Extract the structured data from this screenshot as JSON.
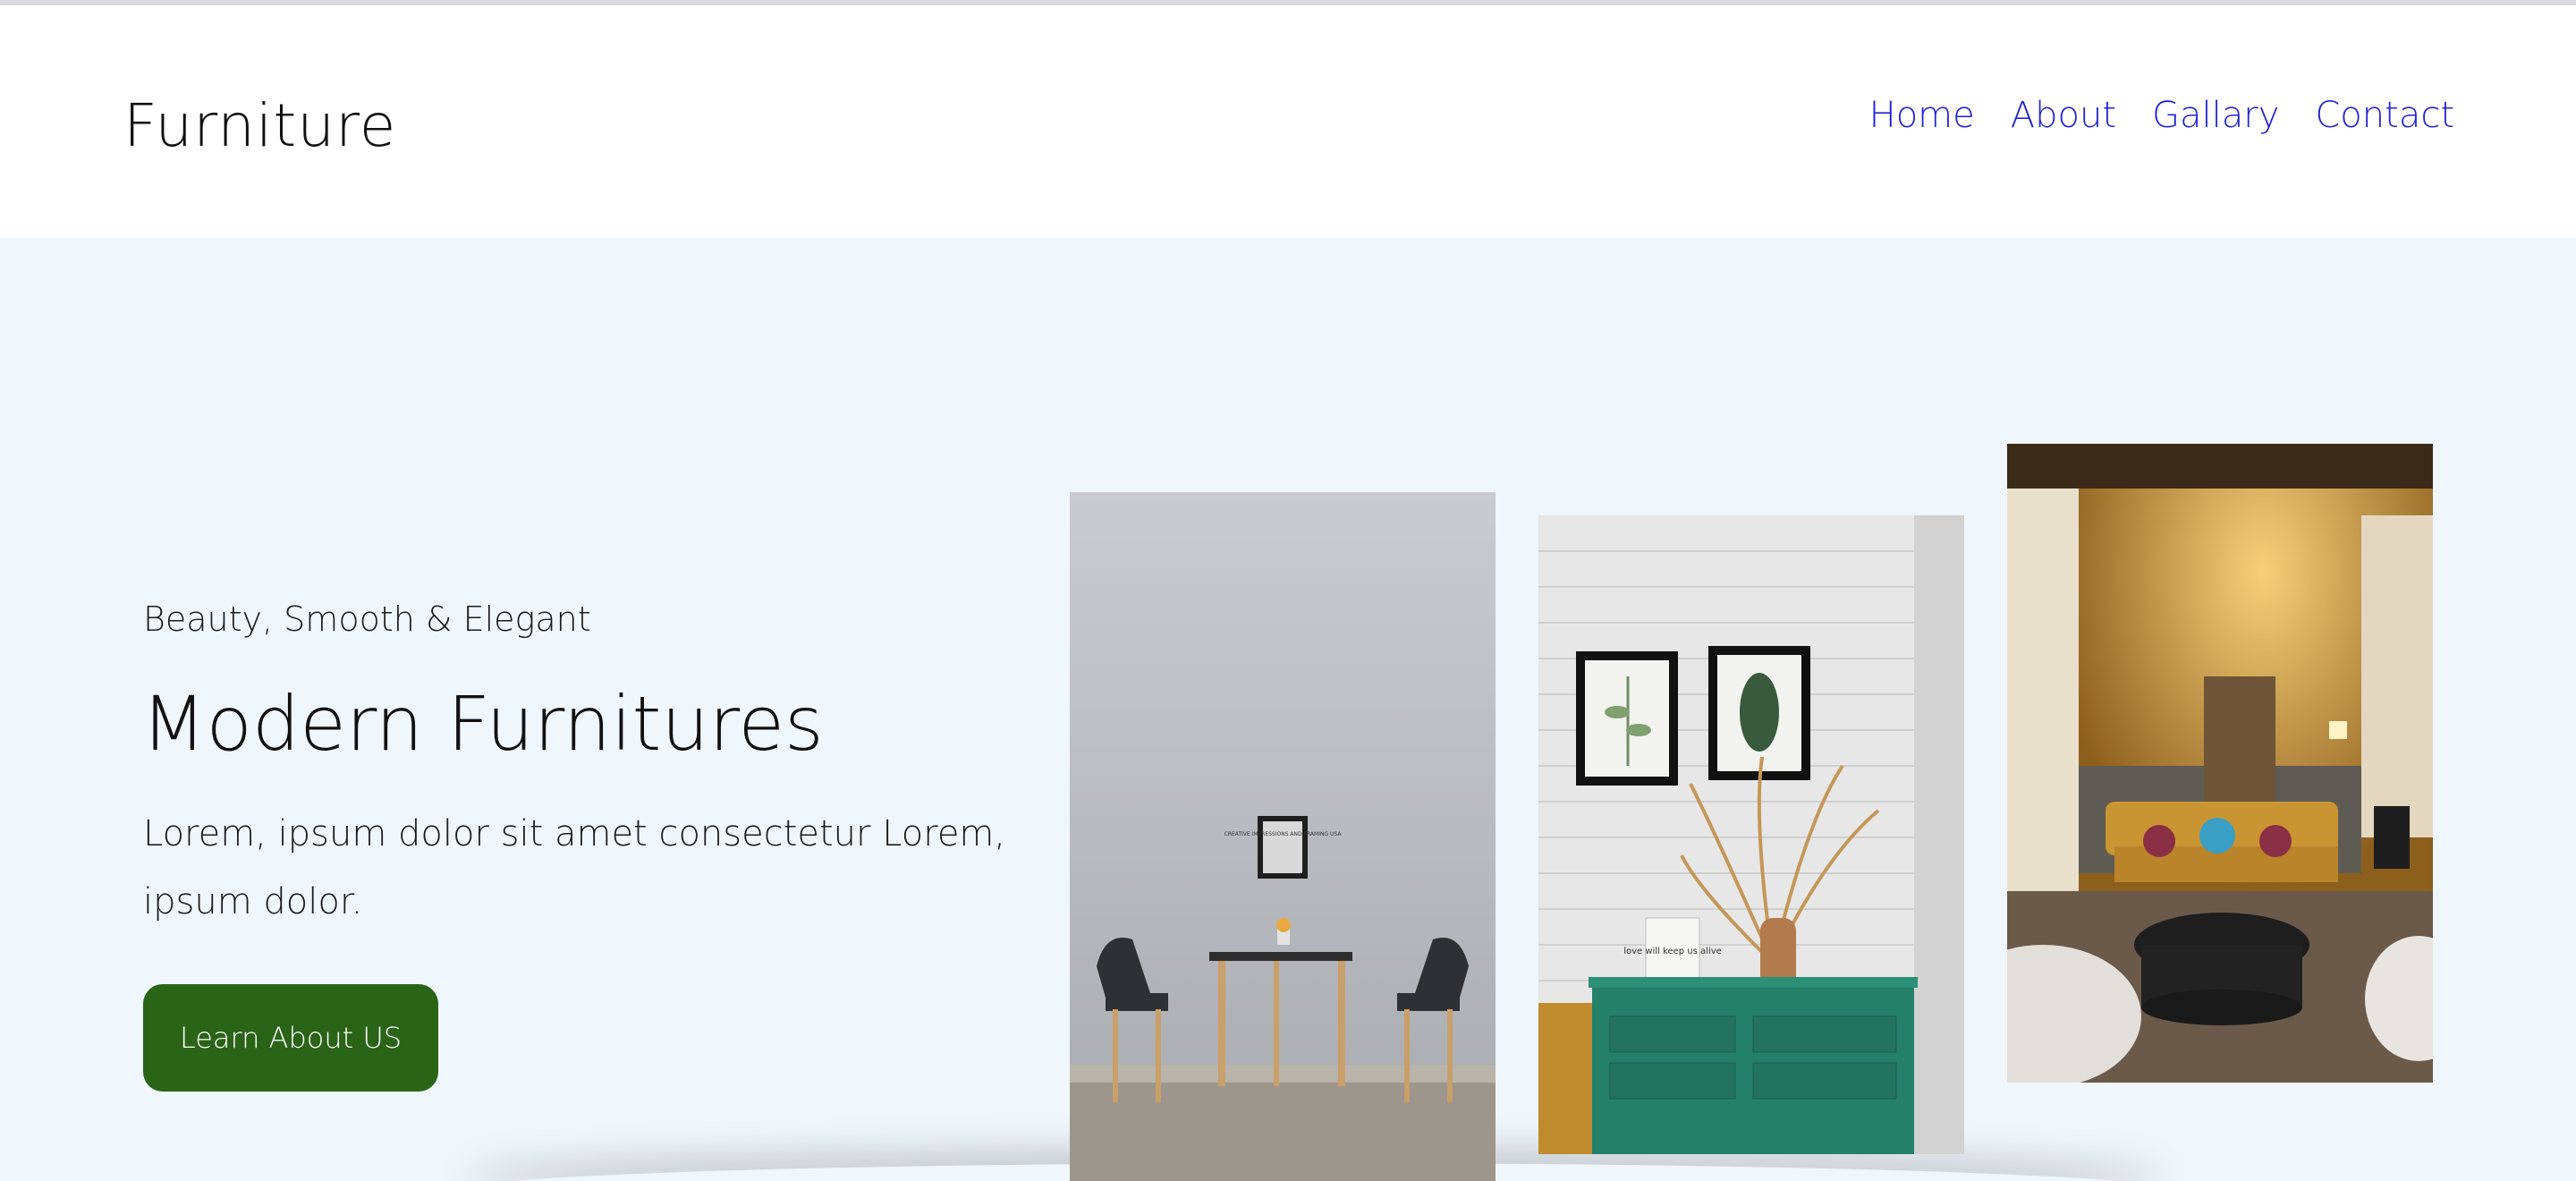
{
  "brand": "Furniture",
  "nav": {
    "items": [
      "Home",
      "About",
      "Gallary",
      "Contact"
    ]
  },
  "hero": {
    "tagline": "Beauty, Smooth & Elegant",
    "title": "Modern Furnitures",
    "description": "Lorem, ipsum dolor sit amet consectetur Lorem, ipsum dolor.",
    "cta_label": "Learn About US"
  },
  "images": [
    {
      "name": "dining-chairs-photo",
      "frame_text": "CREATIVE IMPRESSIONS AND FRAMING USA"
    },
    {
      "name": "green-dresser-photo",
      "frame_text": "love will keep us alive"
    },
    {
      "name": "living-room-photo"
    }
  ],
  "colors": {
    "nav_link": "#2323d6",
    "hero_bg": "#eff6fc",
    "cta_bg": "#2a6416"
  }
}
